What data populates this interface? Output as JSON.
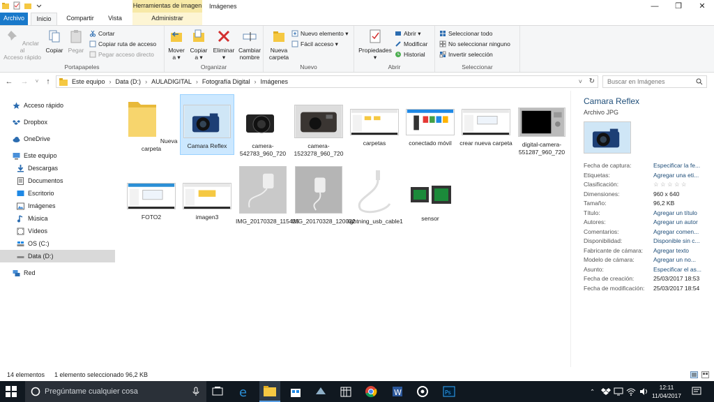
{
  "titlebar": {
    "context_tab": "Herramientas de imagen",
    "window_title": "Imágenes",
    "minimize": "—",
    "maximize": "❐",
    "close": "✕"
  },
  "tabs": {
    "file": "Archivo",
    "home": "Inicio",
    "share": "Compartir",
    "view": "Vista",
    "manage": "Administrar"
  },
  "ribbon": {
    "portapapeles": {
      "label": "Portapapeles",
      "pin": "Anclar al\nAcceso rápido",
      "copy": "Copiar",
      "paste": "Pegar",
      "cut": "Cortar",
      "copy_path": "Copiar ruta de acceso",
      "paste_shortcut": "Pegar acceso directo"
    },
    "organizar": {
      "label": "Organizar",
      "move": "Mover\na ▾",
      "copy": "Copiar\na ▾",
      "delete": "Eliminar\n▾",
      "rename": "Cambiar\nnombre"
    },
    "nuevo": {
      "label": "Nuevo",
      "new_folder": "Nueva\ncarpeta",
      "new_item": "Nuevo elemento ▾",
      "easy_access": "Fácil acceso ▾"
    },
    "abrir": {
      "label": "Abrir",
      "properties": "Propiedades\n▾",
      "open": "Abrir ▾",
      "edit": "Modificar",
      "history": "Historial"
    },
    "seleccionar": {
      "label": "Seleccionar",
      "select_all": "Seleccionar todo",
      "select_none": "No seleccionar ninguno",
      "invert": "Invertir selección"
    }
  },
  "address": {
    "crumbs": [
      "Este equipo",
      "Data (D:)",
      "AULADIGITAL",
      "Fotografía Digital",
      "Imágenes"
    ],
    "separator": "›",
    "search_placeholder": "Buscar en Imágenes"
  },
  "nav": {
    "quick_access": "Acceso rápido",
    "dropbox": "Dropbox",
    "onedrive": "OneDrive",
    "this_pc": "Este equipo",
    "downloads": "Descargas",
    "documents": "Documentos",
    "desktop": "Escritorio",
    "pictures": "Imágenes",
    "music": "Música",
    "videos": "Vídeos",
    "os_c": "OS (C:)",
    "data_d": "Data (D:)",
    "network": "Red"
  },
  "files": [
    {
      "name": "Nueva carpeta"
    },
    {
      "name": "Camara Reflex"
    },
    {
      "name": "camera-542783_960_720"
    },
    {
      "name": "camera-1523278_960_720"
    },
    {
      "name": "carpetas"
    },
    {
      "name": "conectado móvil"
    },
    {
      "name": "crear nueva carpeta"
    },
    {
      "name": "digital-camera-551287_960_720"
    },
    {
      "name": "FOTO2"
    },
    {
      "name": "imagen3"
    },
    {
      "name": "IMG_20170328_115425"
    },
    {
      "name": "IMG_20170328_120032"
    },
    {
      "name": "lightning_usb_cable1"
    },
    {
      "name": "sensor"
    }
  ],
  "details": {
    "title": "Camara Reflex",
    "type": "Archivo JPG",
    "props": [
      {
        "k": "Fecha de captura:",
        "v": "Especificar la fe..."
      },
      {
        "k": "Etiquetas:",
        "v": "Agregar una eti..."
      },
      {
        "k": "Clasificación:",
        "v": "☆ ☆ ☆ ☆ ☆"
      },
      {
        "k": "Dimensiones:",
        "v": "960 x 640"
      },
      {
        "k": "Tamaño:",
        "v": "96,2 KB"
      },
      {
        "k": "Título:",
        "v": "Agregar un título"
      },
      {
        "k": "Autores:",
        "v": "Agregar un autor"
      },
      {
        "k": "Comentarios:",
        "v": "Agregar comen..."
      },
      {
        "k": "Disponibilidad:",
        "v": "Disponible sin c..."
      },
      {
        "k": "Fabricante de cámara:",
        "v": "Agregar texto"
      },
      {
        "k": "Modelo de cámara:",
        "v": "Agregar un no..."
      },
      {
        "k": "Asunto:",
        "v": "Especificar el as..."
      },
      {
        "k": "Fecha de creación:",
        "v": "25/03/2017 18:53"
      },
      {
        "k": "Fecha de modificación:",
        "v": "25/03/2017 18:54"
      }
    ]
  },
  "status": {
    "count": "14 elementos",
    "selection": "1 elemento seleccionado",
    "size": "96,2 KB"
  },
  "taskbar": {
    "search_placeholder": "Pregúntame cualquier cosa",
    "time": "12:11",
    "date": "11/04/2017"
  },
  "colors": {
    "accent": "#1979ca",
    "selection": "#cce8ff",
    "context_tab": "#f7e9a7",
    "taskbar": "#101820"
  }
}
